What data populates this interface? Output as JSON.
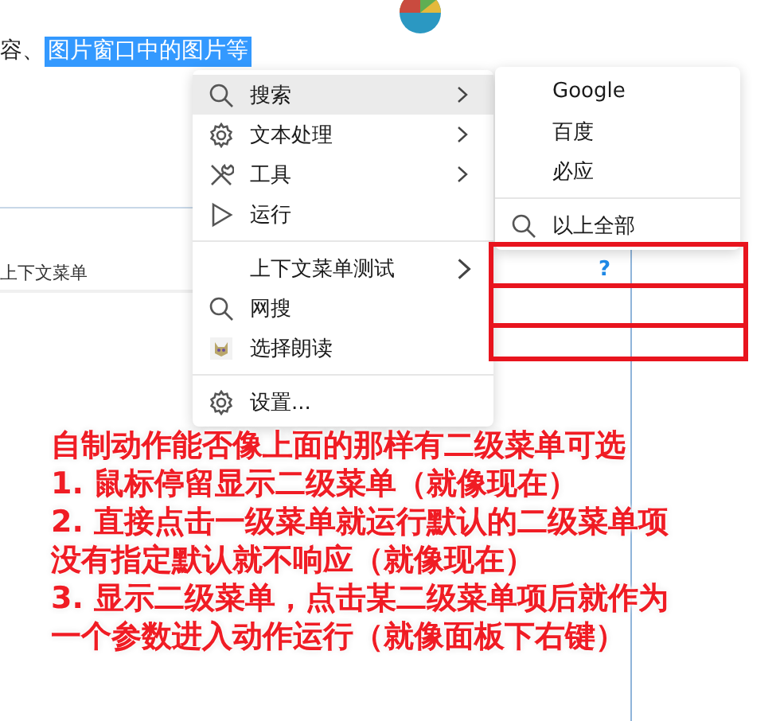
{
  "document": {
    "text_before": "容、",
    "selected_text": "图片窗口中的图片等",
    "list_row": "上下文菜单"
  },
  "context_menu": {
    "items": [
      {
        "kind": "item",
        "label": "搜索",
        "has_submenu": true,
        "selected": true
      },
      {
        "kind": "item",
        "label": "文本处理",
        "has_submenu": true,
        "selected": false
      },
      {
        "kind": "item",
        "label": "工具",
        "has_submenu": true,
        "selected": false
      },
      {
        "kind": "item",
        "label": "运行",
        "has_submenu": false,
        "selected": false
      },
      {
        "kind": "separator"
      },
      {
        "kind": "item",
        "label": "上下文菜单测试",
        "has_submenu": true,
        "selected": false
      },
      {
        "kind": "item",
        "label": "网搜",
        "has_submenu": false,
        "selected": false
      },
      {
        "kind": "item",
        "label": "选择朗读",
        "has_submenu": false,
        "selected": false
      },
      {
        "kind": "separator"
      },
      {
        "kind": "item",
        "label": "设置...",
        "has_submenu": false,
        "selected": false
      }
    ]
  },
  "submenu": {
    "items": [
      {
        "kind": "item",
        "label": "Google"
      },
      {
        "kind": "item",
        "label": "百度"
      },
      {
        "kind": "item",
        "label": "必应"
      },
      {
        "kind": "separator"
      },
      {
        "kind": "item",
        "label": "以上全部"
      }
    ]
  },
  "marked_area": {
    "symbol": "?"
  },
  "annotation": [
    "自制动作能否像上面的那样有二级菜单可选",
    "1. 鼠标停留显示二级菜单（就像现在）",
    "2. 直接点击一级菜单就运行默认的二级菜单项",
    "没有指定默认就不响应（就像现在）",
    "3. 显示二级菜单，点击某二级菜单项后就作为",
    "一个参数进入动作运行（就像面板下右键）"
  ]
}
